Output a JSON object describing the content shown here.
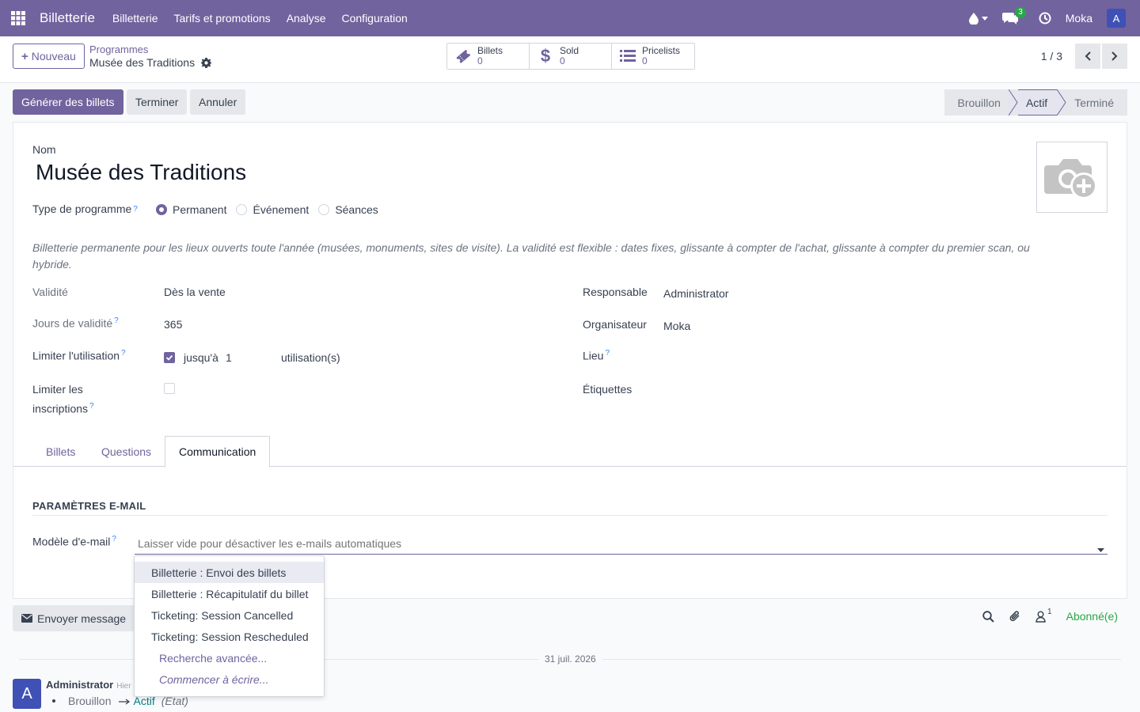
{
  "navbar": {
    "brand": "Billetterie",
    "menu": [
      "Billetterie",
      "Tarifs et promotions",
      "Analyse",
      "Configuration"
    ],
    "messages_count": "3",
    "company": "Moka",
    "user_initial": "A"
  },
  "control_panel": {
    "new_label": "Nouveau",
    "breadcrumb_parent": "Programmes",
    "breadcrumb_current": "Musée des Traditions",
    "smart_buttons": [
      {
        "label": "Billets",
        "value": "0",
        "icon": "ticket-icon"
      },
      {
        "label": "Sold",
        "value": "0",
        "icon": "dollar-icon"
      },
      {
        "label": "Pricelists",
        "value": "0",
        "icon": "list-icon"
      }
    ],
    "pager": "1 / 3"
  },
  "statusbar": {
    "generate": "Générer des billets",
    "finish": "Terminer",
    "cancel": "Annuler",
    "states": [
      "Brouillon",
      "Actif",
      "Terminé"
    ],
    "active_state": "Actif"
  },
  "form": {
    "name_label": "Nom",
    "name": "Musée des Traditions",
    "type_label": "Type de programme",
    "type_options": [
      "Permanent",
      "Événement",
      "Séances"
    ],
    "type_selected": "Permanent",
    "description": "Billetterie permanente pour les lieux ouverts toute l'année (musées, monuments, sites de visite). La validité est flexible : dates fixes, glissante à compter de l'achat, glissante à compter du premier scan, ou hybride.",
    "validity_label": "Validité",
    "validity_value": "Dès la vente",
    "days_label": "Jours de validité",
    "days_value": "365",
    "limit_use_label": "Limiter l'utilisation",
    "limit_use_prefix": "jusqu'à",
    "limit_use_count": "1",
    "limit_use_suffix": "utilisation(s)",
    "limit_reg_label_1": "Limiter les",
    "limit_reg_label_2": "inscriptions",
    "responsible_label": "Responsable",
    "responsible_value": "Administrator",
    "organizer_label": "Organisateur",
    "organizer_value": "Moka",
    "venue_label": "Lieu",
    "tags_label": "Étiquettes"
  },
  "tabs": [
    "Billets",
    "Questions",
    "Communication"
  ],
  "active_tab": "Communication",
  "communication": {
    "section_title": "PARAMÈTRES E-MAIL",
    "template_label": "Modèle d'e-mail",
    "template_placeholder": "Laisser vide pour désactiver les e-mails automatiques"
  },
  "dropdown": {
    "items": [
      "Billetterie : Envoi des billets",
      "Billetterie : Récapitulatif du billet",
      "Ticketing: Session Cancelled",
      "Ticketing: Session Rescheduled"
    ],
    "search_more": "Recherche avancée...",
    "start_typing": "Commencer à écrire..."
  },
  "chatter": {
    "send_message": "Envoyer message",
    "followers_count": "1",
    "subscribed": "Abonné(e)",
    "date": "31 juil. 2026",
    "author": "Administrator",
    "time": "Hier",
    "change_from": "Brouillon",
    "change_to": "Actif",
    "change_field": "(Etat)",
    "avatar_initial": "A"
  },
  "colors": {
    "brand": "#71639e",
    "subscribed": "#28a745",
    "link": "#017e84"
  }
}
